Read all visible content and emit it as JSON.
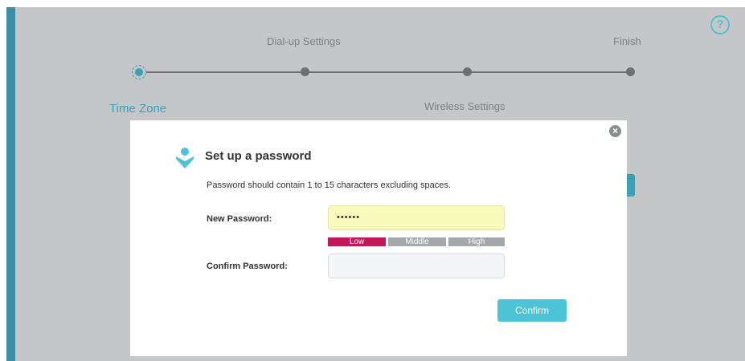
{
  "help": {
    "icon": "question-circle-icon",
    "glyph": "?"
  },
  "steps": {
    "top_labels": [
      "Dial-up Settings",
      "Finish"
    ],
    "bottom_labels": [
      "Time Zone",
      "Wireless Settings"
    ],
    "active_step": "Time Zone",
    "accent_color": "#3aa2b8"
  },
  "modal": {
    "title": "Set up a password",
    "icon": "user-shield-icon",
    "close_glyph": "×",
    "description": "Password should contain 1 to 15 characters excluding spaces.",
    "new_password": {
      "label": "New Password:",
      "value": "••••••"
    },
    "strength": {
      "low": "Low",
      "middle": "Middle",
      "high": "High",
      "active_level": "Low",
      "active_color": "#c2185b",
      "inactive_color": "#a5a8ab"
    },
    "confirm_password": {
      "label": "Confirm Password:",
      "value": ""
    },
    "confirm_button": "Confirm",
    "button_color": "#4dc3d7"
  }
}
